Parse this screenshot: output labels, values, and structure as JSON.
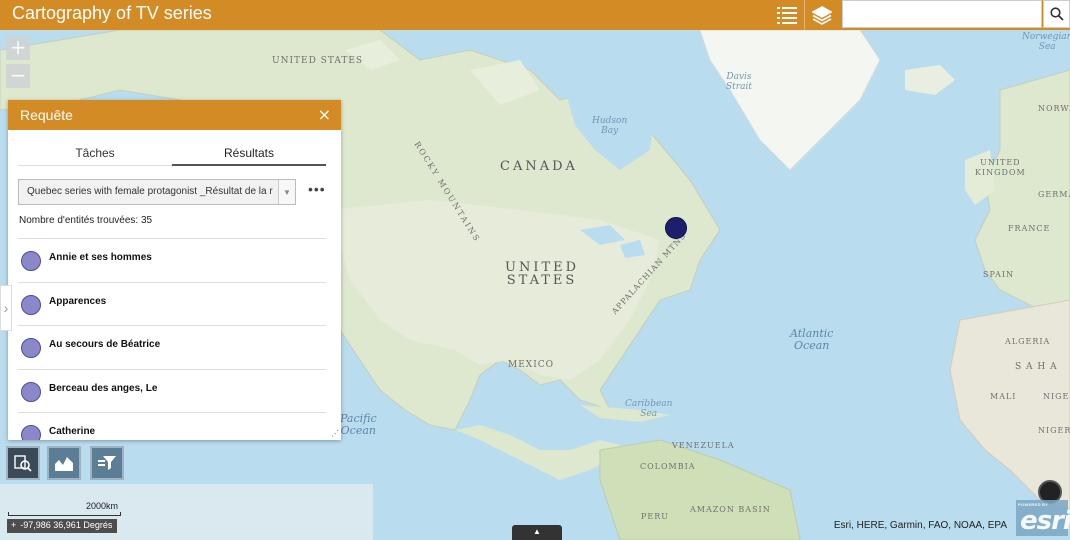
{
  "app": {
    "title": "Cartography of TV series",
    "search": {
      "value": "",
      "placeholder": ""
    }
  },
  "icons": {
    "list": "list-icon",
    "layers": "layers-icon",
    "search": "search-icon",
    "close": "close-icon",
    "more": "more-icon",
    "query_widget": "query-search-icon",
    "chart_widget": "chart-icon",
    "filter_widget": "filter-icon"
  },
  "colors": {
    "brand": "#d38b25",
    "result_dot": "#8b87c9",
    "map_point": "#1b1f6e"
  },
  "map": {
    "zoom_in": "+",
    "zoom_out": "−",
    "labels": {
      "canada": "CANADA",
      "us": "UNITED\nSTATES",
      "us_small": "UNITED\nSTATES",
      "mexico": "MEXICO",
      "rocky": "ROCKY MOUNTAINS",
      "appalachian": "APPALACHIAN MTNS",
      "atlantic": "Atlantic\nOcean",
      "pacific": "Pacific\nOcean",
      "hudson": "Hudson\nBay",
      "davis": "Davis\nStrait",
      "norwegian": "Norwegian\nSea",
      "uk": "UNITED\nKINGDOM",
      "france": "FRANCE",
      "spain": "SPAIN",
      "norway": "NORWA",
      "germany": "GERMA",
      "algeria": "ALGERIA",
      "sahara": "S A H A",
      "mali": "MALI",
      "niger": "NIGE",
      "nigeria": "NIGER",
      "venezuela": "VENEZUELA",
      "colombia": "COLOMBIA",
      "peru": "PERU",
      "amazon": "AMAZON BASIN",
      "caribbean": "Caribbean\nSea"
    },
    "scale": "2000km",
    "coordinates": "-97,986 36,961 Degrés",
    "attribution": "Esri, HERE, Garmin, FAO, NOAA, EPA",
    "esri_powered": "POWERED BY",
    "esri_logo": "esri",
    "bottom_handle": "▲"
  },
  "panel": {
    "title": "Requête",
    "close": "×",
    "tabs": [
      "Tâches",
      "Résultats"
    ],
    "selected_query": "Quebec series with female protagonist _Résultat de la r",
    "more": "•••",
    "count_text": "Nombre d'entités trouvées: 35",
    "results": [
      "Annie et ses hommes",
      "Apparences",
      "Au secours de Béatrice",
      "Berceau des anges, Le",
      "Catherine"
    ],
    "collapse": "›"
  }
}
